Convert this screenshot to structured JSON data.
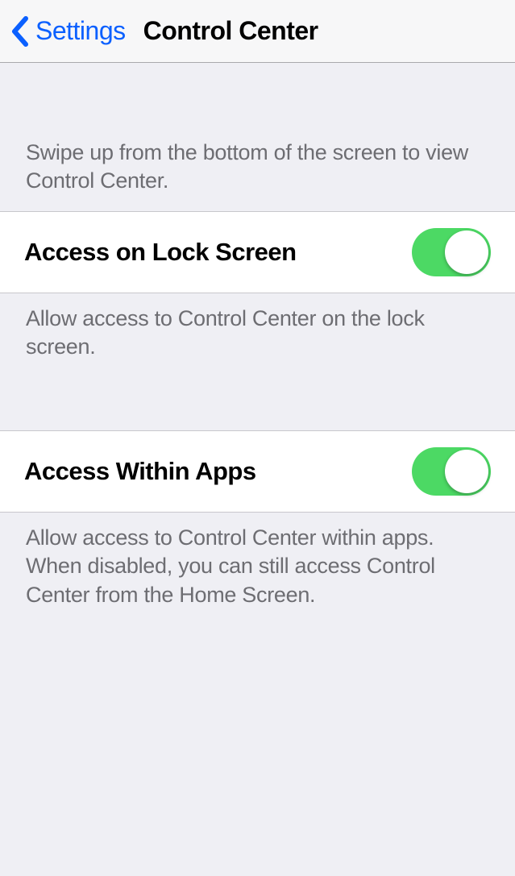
{
  "nav": {
    "back_label": "Settings",
    "title": "Control Center"
  },
  "sections": {
    "intro_text": "Swipe up from the bottom of the screen to view Control Center.",
    "lock_screen": {
      "label": "Access on Lock Screen",
      "footer": "Allow access to Control Center on the lock screen.",
      "enabled": true
    },
    "within_apps": {
      "label": "Access Within Apps",
      "footer": "Allow access to Control Center within apps. When disabled, you can still access Control Center from the Home Screen.",
      "enabled": true
    }
  }
}
